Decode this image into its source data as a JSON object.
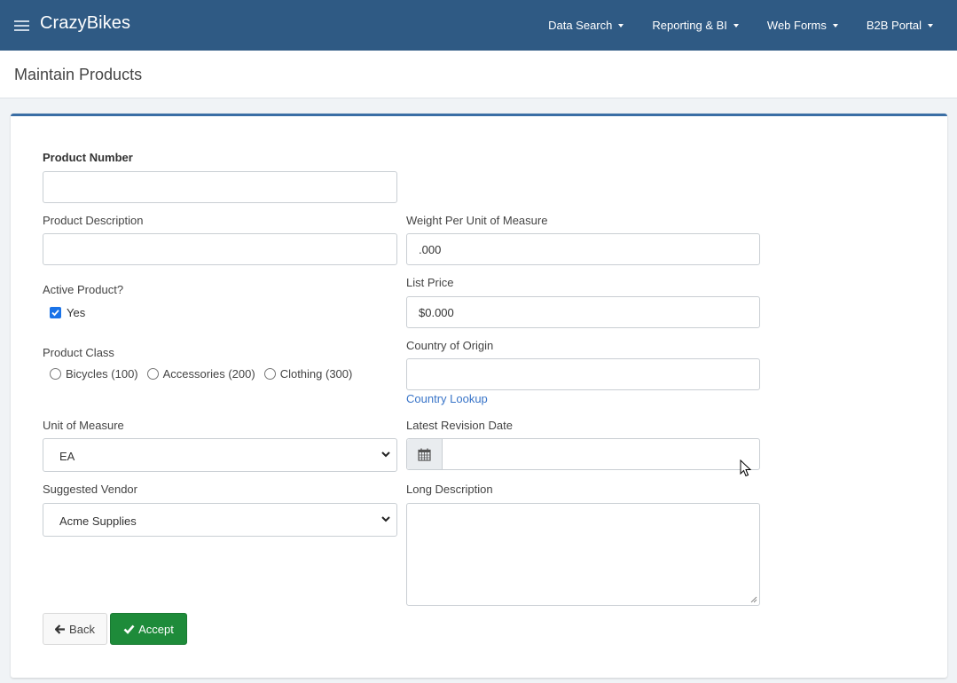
{
  "app": {
    "brand": "CrazyBikes"
  },
  "nav": {
    "items": [
      "Data Search",
      "Reporting & BI",
      "Web Forms",
      "B2B Portal"
    ]
  },
  "page": {
    "title": "Maintain Products"
  },
  "form": {
    "product_number": {
      "label": "Product Number",
      "value": ""
    },
    "product_description": {
      "label": "Product Description",
      "value": ""
    },
    "weight": {
      "label": "Weight Per Unit of Measure",
      "value": ".000"
    },
    "active": {
      "label": "Active Product?",
      "option": "Yes",
      "checked": true
    },
    "list_price": {
      "label": "List Price",
      "value": "$0.000"
    },
    "product_class": {
      "label": "Product Class",
      "options": [
        "Bicycles (100)",
        "Accessories (200)",
        "Clothing (300)"
      ]
    },
    "country": {
      "label": "Country of Origin",
      "value": "",
      "lookup_link": "Country Lookup"
    },
    "unit_of_measure": {
      "label": "Unit of Measure",
      "selected": "EA"
    },
    "revision_date": {
      "label": "Latest Revision Date",
      "value": ""
    },
    "vendor": {
      "label": "Suggested Vendor",
      "selected": "Acme Supplies"
    },
    "long_description": {
      "label": "Long Description",
      "value": ""
    }
  },
  "buttons": {
    "back": "Back",
    "accept": "Accept"
  },
  "colors": {
    "navbar": "#2f5a84",
    "accent": "#3a6ea5",
    "accept": "#1e8b3a",
    "link": "#3874c8"
  }
}
